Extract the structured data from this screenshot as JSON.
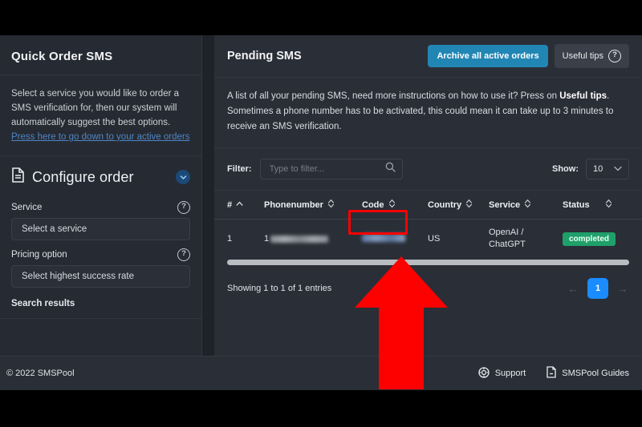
{
  "sidebar": {
    "title": "Quick Order SMS",
    "description": "Select a service you would like to order a SMS verification for, then our system will automatically suggest the best options.",
    "link": "Press here to go down to your active orders",
    "configure": {
      "title": "Configure order",
      "doc_icon": "document-icon",
      "chevron_icon": "chevron-down-circle-icon",
      "service_label": "Service",
      "service_value": "Select a service",
      "service_help_icon": "help-circle-icon",
      "pricing_label": "Pricing option",
      "pricing_value": "Select highest success rate",
      "pricing_help_icon": "help-circle-icon",
      "search_results_label": "Search results"
    }
  },
  "main": {
    "title": "Pending SMS",
    "archive_button": "Archive all active orders",
    "tips_button": "Useful tips",
    "tips_icon": "help-circle-icon",
    "description_1": "A list of all your pending SMS, need more instructions on how to use it? Press on ",
    "description_bold": "Useful tips",
    "description_2": ". Sometimes a phone number has to be activated, this could mean it can take up to 3 minutes to receive an SMS verification.",
    "filter_label": "Filter:",
    "filter_placeholder": "Type to filter...",
    "filter_value": "",
    "search_icon": "search-icon",
    "show_label": "Show:",
    "show_value": "10",
    "show_chevron_icon": "chevron-down-icon",
    "table": {
      "columns": [
        {
          "label": "#",
          "sort_icon": "sort-asc-icon"
        },
        {
          "label": "Phonenumber",
          "sort_icon": "sort-both-icon"
        },
        {
          "label": "Code",
          "sort_icon": "sort-both-icon"
        },
        {
          "label": "Country",
          "sort_icon": "sort-both-icon"
        },
        {
          "label": "Service",
          "sort_icon": "sort-both-icon"
        },
        {
          "label": "Status",
          "sort_icon": "sort-both-icon"
        }
      ],
      "rows": [
        {
          "index": "1",
          "phonenumber_prefix": "1",
          "phonenumber_redacted": true,
          "code_redacted": true,
          "country": "US",
          "service": "OpenAI / ChatGPT",
          "status": "completed"
        }
      ]
    },
    "entries_text": "Showing 1 to 1 of 1 entries",
    "pagination": {
      "prev_icon": "arrow-left-icon",
      "current_page": "1",
      "next_icon": "arrow-right-icon"
    }
  },
  "footer": {
    "copyright": "© 2022 SMSPool",
    "links": [
      {
        "label": "Support",
        "icon": "lifebuoy-icon"
      },
      {
        "label": "SMSPool Guides",
        "icon": "document-guide-icon"
      }
    ]
  },
  "annotation": {
    "highlight_color": "#fd0000",
    "arrow_icon": "up-arrow-annotation",
    "target": "code-cell"
  },
  "colors": {
    "accent_blue": "#2286b4",
    "page_active": "#1a8cff",
    "status_green": "#1fa06a",
    "link_blue": "#4f86c6"
  }
}
